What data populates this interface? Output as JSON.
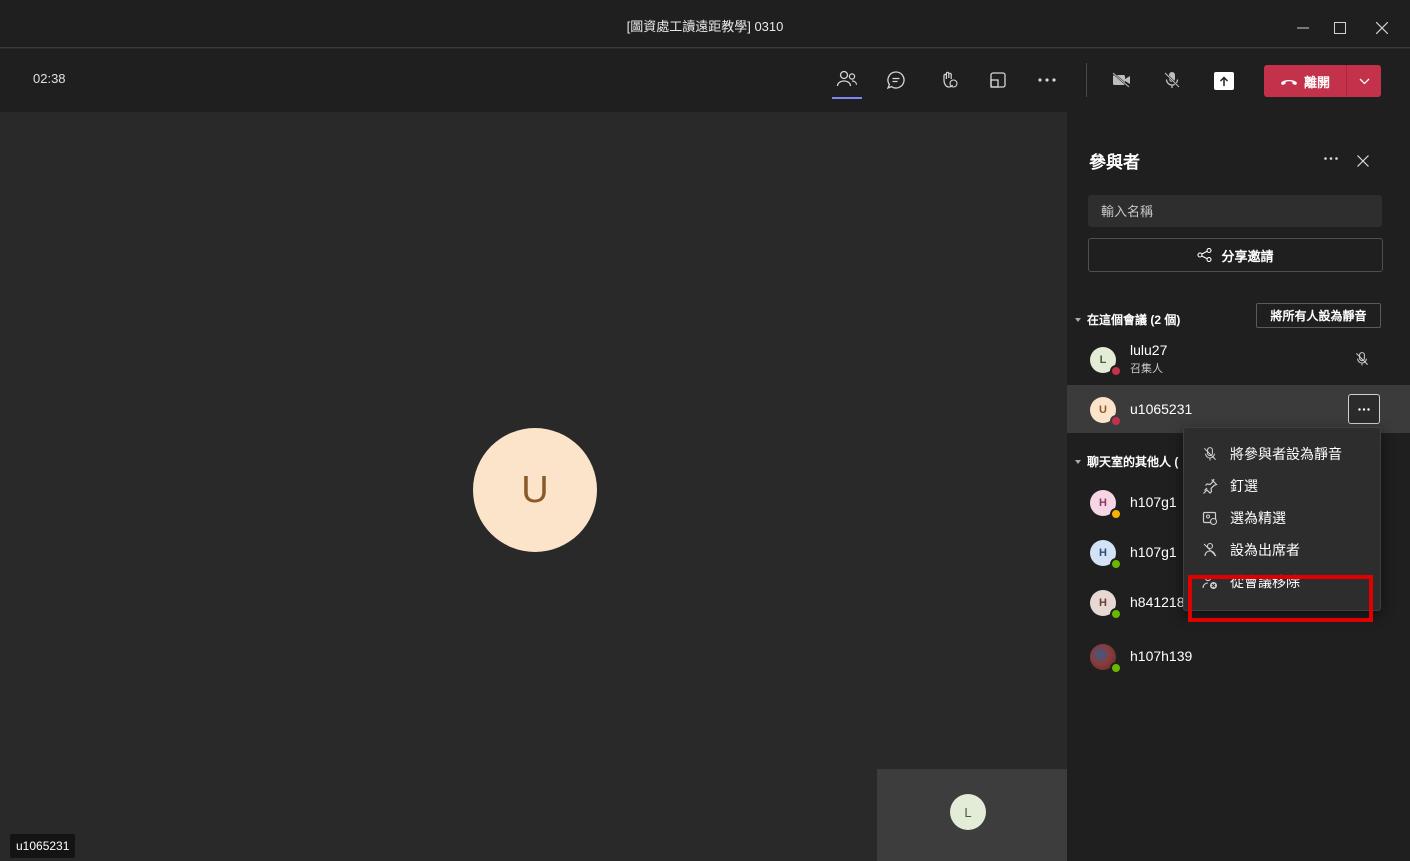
{
  "window": {
    "title": "[圖資處工讀遠距教學] 0310",
    "minimize": "—",
    "maximize": "☐",
    "close": "✕"
  },
  "toolbar": {
    "timer": "02:38",
    "leave_label": "離開"
  },
  "stage": {
    "main_avatar_initial": "U",
    "name_tag": "u1065231",
    "self_avatar_initial": "L"
  },
  "panel": {
    "title": "參與者",
    "search_placeholder": "輸入名稱",
    "invite_label": "分享邀請",
    "in_meeting_header": "在這個會議 (2 個)",
    "mute_all_label": "將所有人設為靜音",
    "others_header": "聊天室的其他人 (",
    "in_meeting": [
      {
        "initial": "L",
        "name": "lulu27",
        "role": "召集人",
        "avatar_bg": "#e3ecd6",
        "avatar_fg": "#4a5d34",
        "status_color": "#c4314b"
      },
      {
        "initial": "U",
        "name": "u1065231",
        "role": "",
        "avatar_bg": "#fce4cb",
        "avatar_fg": "#8a5a2b",
        "status_color": "#c4314b"
      }
    ],
    "others": [
      {
        "initial": "H",
        "name": "h107g1",
        "avatar_bg": "#f6d6e6",
        "avatar_fg": "#8b3a62",
        "status_color": "#f8b400"
      },
      {
        "initial": "H",
        "name": "h107g1",
        "avatar_bg": "#d4e2f5",
        "avatar_fg": "#2d4e7a",
        "status_color": "#6bb700"
      },
      {
        "initial": "H",
        "name": "h841218",
        "avatar_bg": "#e8d8d4",
        "avatar_fg": "#6b3e35",
        "status_color": "#6bb700"
      },
      {
        "initial": "",
        "name": "h107h139",
        "avatar_bg": "#8a3b3b",
        "avatar_fg": "#ffffff",
        "status_color": "#6bb700"
      }
    ]
  },
  "context_menu": {
    "items": [
      {
        "label": "將參與者設為靜音",
        "icon": "mic-off-icon"
      },
      {
        "label": "釘選",
        "icon": "pin-icon"
      },
      {
        "label": "選為精選",
        "icon": "spotlight-icon"
      },
      {
        "label": "設為出席者",
        "icon": "attendee-icon"
      },
      {
        "label": "從會議移除",
        "icon": "remove-person-icon"
      }
    ]
  },
  "colors": {
    "leave_red": "#c4314b",
    "active_indicator": "#7f85f5",
    "highlight_box": "#e00000"
  }
}
